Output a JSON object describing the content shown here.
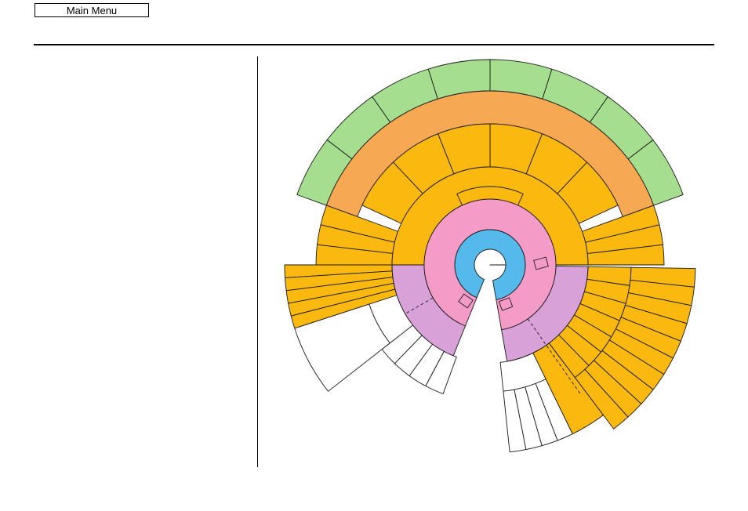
{
  "header": {
    "main_menu_label": "Main Menu"
  },
  "colors": {
    "center_hole": "#ffffff",
    "core_blue": "#55b9ec",
    "pink": "#f59bc7",
    "lavender": "#d8a2d9",
    "orange_yellow": "#fbb80f",
    "light_orange": "#f7a852",
    "green": "#a5de8e",
    "white_segment": "#ffffff",
    "outline": "#1a1a1a"
  },
  "icons": {
    "small_square_markers": [
      "square-marker-icon",
      "square-marker-icon",
      "square-marker-icon"
    ]
  }
}
